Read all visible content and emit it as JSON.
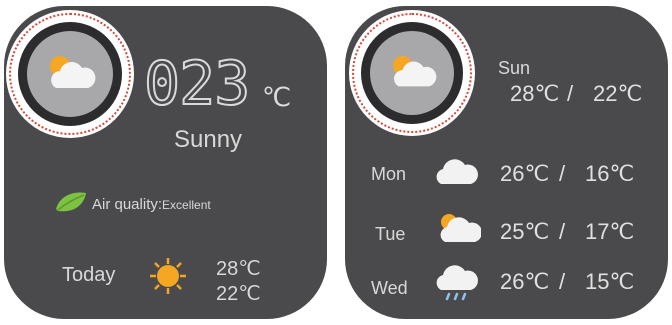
{
  "left": {
    "temperature": "023",
    "unit": "℃",
    "condition": "Sunny",
    "air_quality_label": "Air quality:",
    "air_quality_value": "Excellent",
    "today_label": "Today",
    "today_high": "28℃",
    "today_low": "22℃"
  },
  "right": {
    "current": {
      "day": "Sun",
      "high": "28℃",
      "low": "22℃",
      "separator": "/"
    },
    "forecast": [
      {
        "day": "Mon",
        "high": "26℃",
        "low": "16℃",
        "separator": "/",
        "icon": "cloud-icon"
      },
      {
        "day": "Tue",
        "high": "25℃",
        "low": "17℃",
        "separator": "/",
        "icon": "sun-cloud-icon"
      },
      {
        "day": "Wed",
        "high": "26℃",
        "low": "15℃",
        "separator": "/",
        "icon": "rain-cloud-icon"
      }
    ]
  },
  "colors": {
    "panel": "#4a4a4c",
    "text": "#d8d8d8",
    "dots": "#d24a3a",
    "sun": "#f5a623",
    "leaf": "#7dc242"
  }
}
